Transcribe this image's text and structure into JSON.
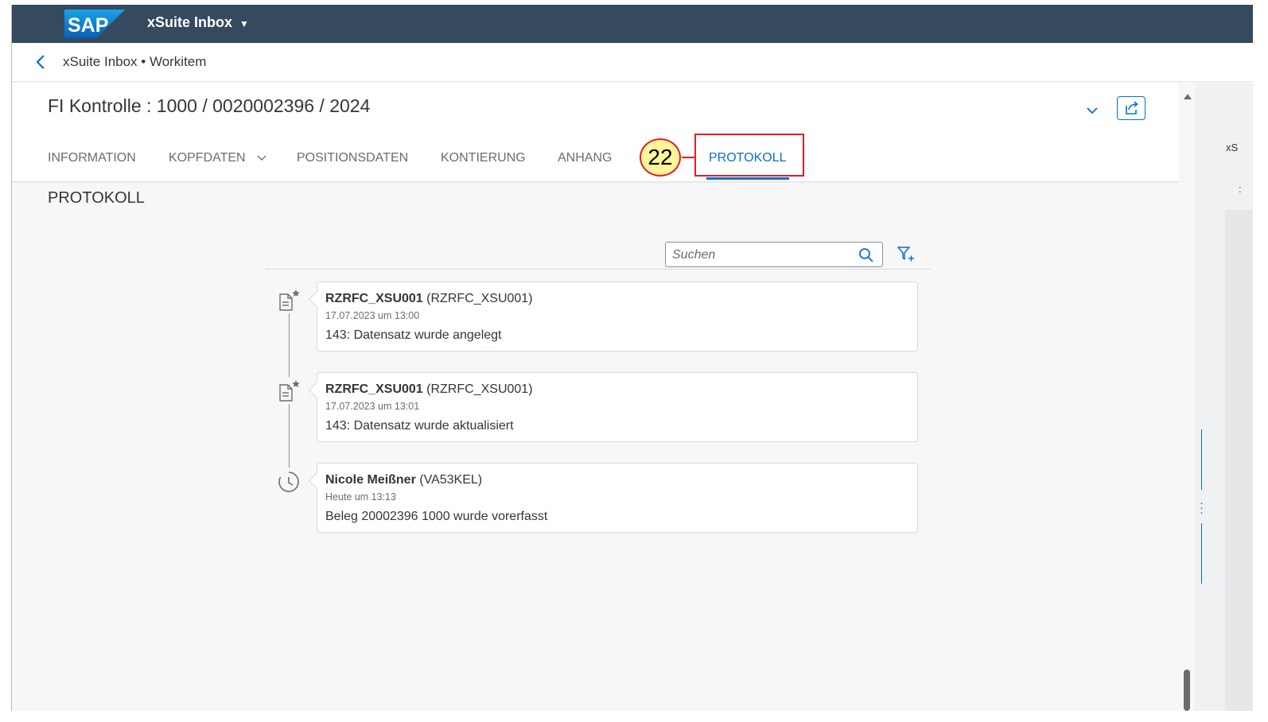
{
  "shell": {
    "logo_text": "SAP",
    "app_title": "xSuite Inbox",
    "app_caret": "▼"
  },
  "breadcrumb": {
    "text": "xSuite Inbox • Workitem"
  },
  "header": {
    "title": "FI Kontrolle : 1000 / 0020002396 / 2024"
  },
  "tabs": [
    {
      "label": "INFORMATION"
    },
    {
      "label": "KOPFDATEN",
      "has_dropdown": true
    },
    {
      "label": "POSITIONSDATEN"
    },
    {
      "label": "KONTIERUNG"
    },
    {
      "label": "ANHANG"
    },
    {
      "label": "PROTOKOLL",
      "active": true
    }
  ],
  "annotation": {
    "step_number": "22"
  },
  "section": {
    "title": "PROTOKOLL"
  },
  "search": {
    "placeholder": "Suchen"
  },
  "entries": [
    {
      "icon": "document-star-icon",
      "author_name": "RZRFC_XSU001",
      "author_id": "(RZRFC_XSU001)",
      "date": "17.07.2023 um 13:00",
      "message": "143: Datensatz wurde angelegt"
    },
    {
      "icon": "document-star-icon",
      "author_name": "RZRFC_XSU001",
      "author_id": "(RZRFC_XSU001)",
      "date": "17.07.2023 um 13:01",
      "message": "143: Datensatz wurde aktualisiert"
    },
    {
      "icon": "clock-icon",
      "author_name": "Nicole Meißner",
      "author_id": "(VA53KEL)",
      "date": "Heute um 13:13",
      "message": "Beleg 20002396 1000 wurde vorerfasst"
    }
  ],
  "right_panel": {
    "label": "xS",
    "colon": ":"
  },
  "colors": {
    "shell": "#354a5f",
    "accent": "#0a6ed1",
    "callout_border": "#e31e24",
    "callout_fill": "#fff69a"
  }
}
